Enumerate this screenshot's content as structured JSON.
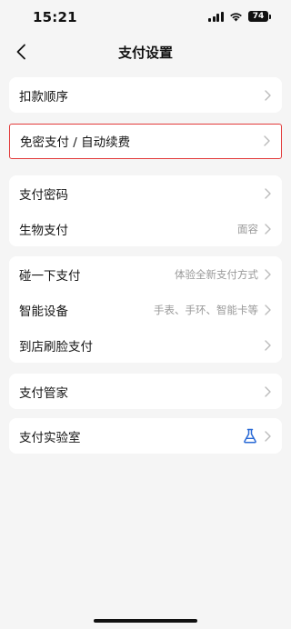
{
  "status_bar": {
    "time": "15:21",
    "battery": "74"
  },
  "header": {
    "title": "支付设置",
    "back_icon": "chevron-left-icon"
  },
  "sections": [
    {
      "items": [
        {
          "label": "扣款顺序",
          "value": ""
        }
      ]
    },
    {
      "items": [
        {
          "label": "免密支付 / 自动续费",
          "value": ""
        }
      ],
      "highlighted": true
    },
    {
      "items": [
        {
          "label": "支付密码",
          "value": ""
        },
        {
          "label": "生物支付",
          "value": "面容"
        }
      ]
    },
    {
      "items": [
        {
          "label": "碰一下支付",
          "value": "体验全新支付方式"
        },
        {
          "label": "智能设备",
          "value": "手表、手环、智能卡等"
        },
        {
          "label": "到店刷脸支付",
          "value": ""
        }
      ]
    },
    {
      "items": [
        {
          "label": "支付管家",
          "value": ""
        }
      ]
    },
    {
      "items": [
        {
          "label": "支付实验室",
          "value": "",
          "icon": "flask-icon"
        }
      ]
    }
  ],
  "colors": {
    "background": "#f5f5f5",
    "card": "#ffffff",
    "highlight_border": "#e23b3b",
    "flask_icon": "#2a6ad6",
    "secondary_text": "#999999"
  }
}
